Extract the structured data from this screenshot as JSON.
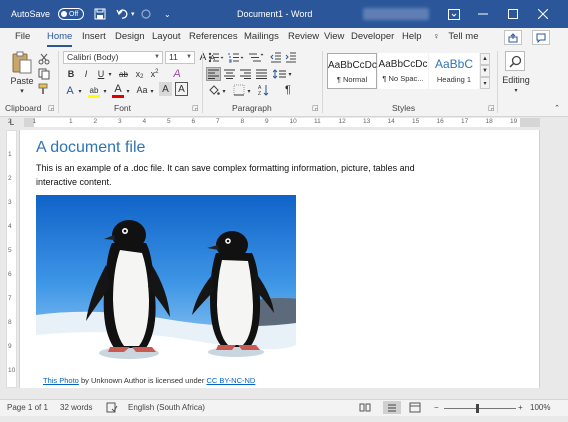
{
  "window": {
    "autosave_label": "AutoSave",
    "autosave_state": "Off",
    "title": "Document1 - Word",
    "colors": {
      "accent": "#2b579a",
      "ribbon_bg": "#f3f3f3",
      "heading": "#2e74b5",
      "link": "#0563c1"
    }
  },
  "qat": {
    "save_icon": "save-icon",
    "undo_icon": "undo-icon",
    "redo_icon": "redo-icon"
  },
  "window_controls": {
    "ribbon_display_icon": "ribbon-display-icon",
    "minimize": "minimize-icon",
    "maximize": "maximize-icon",
    "close": "close-icon"
  },
  "tabs": [
    {
      "label": "File"
    },
    {
      "label": "Home",
      "active": true
    },
    {
      "label": "Insert"
    },
    {
      "label": "Design"
    },
    {
      "label": "Layout"
    },
    {
      "label": "References"
    },
    {
      "label": "Mailings"
    },
    {
      "label": "Review"
    },
    {
      "label": "View"
    },
    {
      "label": "Developer"
    },
    {
      "label": "Help"
    }
  ],
  "tell_me": "Tell me",
  "ribbon": {
    "clipboard": {
      "paste_label": "Paste",
      "group_label": "Clipboard"
    },
    "font": {
      "font_name": "Calibri (Body)",
      "font_size": "11",
      "grow": "A",
      "shrink": "A",
      "case_label": "Aa",
      "bold": "B",
      "italic": "I",
      "underline": "U",
      "strike": "ab",
      "subscript": "x",
      "superscript": "x",
      "text_effects": "A",
      "highlight": "ab",
      "font_color": "A",
      "char_shading": "A",
      "group_label": "Font"
    },
    "paragraph": {
      "group_label": "Paragraph",
      "show_marks": "¶"
    },
    "styles": {
      "items": [
        {
          "preview": "AaBbCcDc",
          "name": "¶ Normal"
        },
        {
          "preview": "AaBbCcDc",
          "name": "¶ No Spac..."
        },
        {
          "preview": "AaBbC",
          "name": "Heading 1"
        }
      ],
      "group_label": "Styles"
    },
    "editing": {
      "label": "Editing"
    }
  },
  "ruler": {
    "h_ticks": [
      "2",
      "1",
      "1",
      "2",
      "3",
      "4",
      "5",
      "6",
      "7",
      "8",
      "9",
      "10",
      "11",
      "12",
      "13",
      "14",
      "15",
      "16",
      "17",
      "18",
      "19"
    ],
    "v_ticks": [
      "1",
      "2",
      "3",
      "4",
      "5",
      "6",
      "7",
      "8",
      "9",
      "10"
    ]
  },
  "document": {
    "title": "A document file",
    "body": "This is an example of a .doc file. It can save complex formatting information, picture, tables and interactive content.",
    "caption": {
      "link1": "This Photo",
      "mid": " by Unknown Author is licensed under ",
      "link2": "CC BY-NC-ND"
    }
  },
  "status": {
    "page": "Page 1 of 1",
    "words": "32 words",
    "language": "English (South Africa)",
    "zoom_out": "−",
    "zoom_in": "+",
    "zoom": "100%"
  }
}
